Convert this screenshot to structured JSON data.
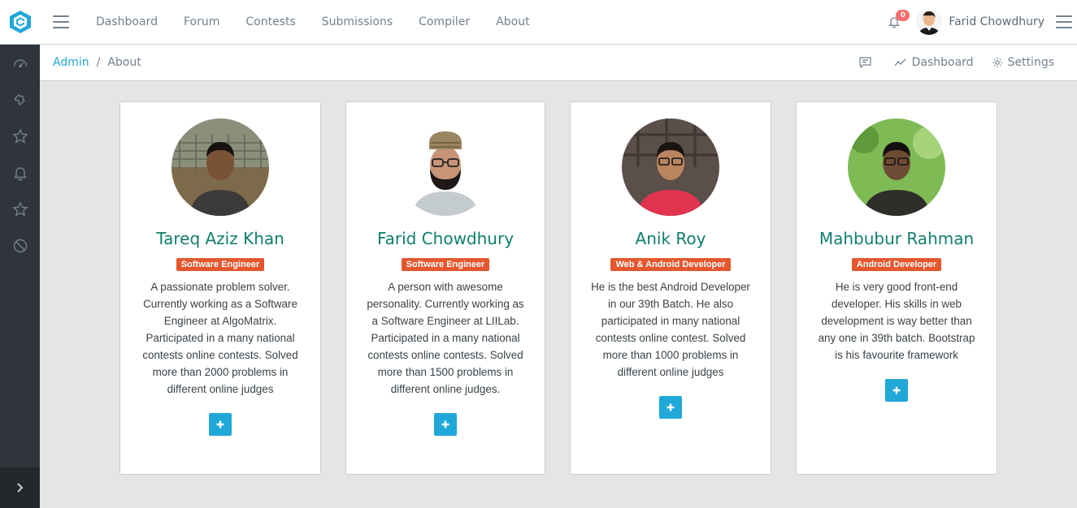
{
  "nav": {
    "items": [
      "Dashboard",
      "Forum",
      "Contests",
      "Submissions",
      "Compiler",
      "About"
    ]
  },
  "user": {
    "name": "Farid Chowdhury",
    "notification_count": "0"
  },
  "breadcrumb": {
    "parent": "Admin",
    "separator": "/",
    "current": "About"
  },
  "crumb_menu": {
    "dashboard": "Dashboard",
    "settings": "Settings"
  },
  "colors": {
    "accent": "#20a8d8",
    "name": "#0f7e6b",
    "role_badge": "#e4572e",
    "sidebar": "#2f353a"
  },
  "sidebar": {
    "icons": [
      "speedometer-icon",
      "puzzle-icon",
      "star-icon",
      "bell-icon",
      "star-icon",
      "ban-icon"
    ]
  },
  "members": [
    {
      "name": "Tareq Aziz Khan",
      "role": "Software Engineer",
      "description": "A passionate problem solver. Currently working as a Software Engineer at AlgoMatrix. Participated in a many national contests online contests. Solved more than 2000 problems in different online judges"
    },
    {
      "name": "Farid Chowdhury",
      "role": "Software Engineer",
      "description": "A person with awesome personality. Currently working as a Software Engineer at LIILab. Participated in a many national contests online contests. Solved more than 1500 problems in different online judges."
    },
    {
      "name": "Anik Roy",
      "role": "Web & Android Developer",
      "description": "He is the best Android Developer in our 39th Batch. He also participated in many national contests online contest. Solved more than 1000 problems in different online judges"
    },
    {
      "name": "Mahbubur Rahman",
      "role": "Android Developer",
      "description": "He is very good front-end developer. His skills in web development is way better than any one in 39th batch. Bootstrap is his favourite framework"
    }
  ]
}
